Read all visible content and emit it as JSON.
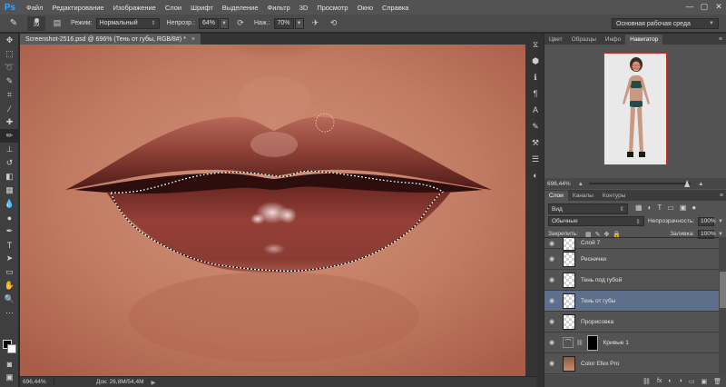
{
  "app": {
    "logo": "Ps"
  },
  "menu": [
    "Файл",
    "Редактирование",
    "Изображение",
    "Слои",
    "Шрифт",
    "Выделение",
    "Фильтр",
    "3D",
    "Просмотр",
    "Окно",
    "Справка"
  ],
  "window_controls": [
    "—",
    "▢",
    "✕"
  ],
  "options": {
    "brush_size": "39",
    "mode_label": "Режим:",
    "mode_value": "Нормальный",
    "opacity_label": "Непрозр.:",
    "opacity_value": "64%",
    "flow_label": "Наж.:",
    "flow_value": "70%",
    "workspace": "Основная рабочая среда"
  },
  "document": {
    "tab_title": "Screenshot-2516.psd @ 696% (Тень от губы, RGB/8#) *",
    "tab_close": "×"
  },
  "status": {
    "zoom": "696,44%",
    "doc_info": "Док: 26,8M/54,4M",
    "arrow": "▶"
  },
  "navigator": {
    "tabs": [
      "Цвет",
      "Образцы",
      "Инфо",
      "Навигатор"
    ],
    "active_tab": "Навигатор",
    "zoom": "696,44%",
    "zoom_level": 0.97
  },
  "layers_panel": {
    "tabs": [
      "Слои",
      "Каналы",
      "Контуры"
    ],
    "active_tab": "Слои",
    "kind_filter": "Вид",
    "blend_mode": "Обычные",
    "opacity_label": "Непрозрачность:",
    "opacity_value": "100%",
    "lock_label": "Закрепить:",
    "fill_label": "Заливка:",
    "fill_value": "100%",
    "layers": [
      {
        "name": "Слой 7",
        "type": "pixel",
        "visible": true,
        "selected": false
      },
      {
        "name": "Реснички",
        "type": "pixel",
        "visible": true,
        "selected": false
      },
      {
        "name": "Тень под губой",
        "type": "pixel",
        "visible": true,
        "selected": false
      },
      {
        "name": "Тень от губы",
        "type": "pixel",
        "visible": true,
        "selected": true
      },
      {
        "name": "Прорисовка",
        "type": "pixel",
        "visible": true,
        "selected": false
      },
      {
        "name": "Кривые 1",
        "type": "adjustment",
        "visible": true,
        "selected": false
      },
      {
        "name": "Color Efex Pro",
        "type": "smart",
        "visible": true,
        "selected": false
      }
    ],
    "footer_icons": [
      "⛓",
      "fx",
      "◐",
      "◑",
      "▭",
      "▣",
      "🗑"
    ]
  },
  "colors": {
    "accent": "#31a8ff",
    "selected_layer": "#5d6f8a",
    "panel_bg": "#535353",
    "lip": "#8d3c34",
    "skin": "#c17e62"
  }
}
